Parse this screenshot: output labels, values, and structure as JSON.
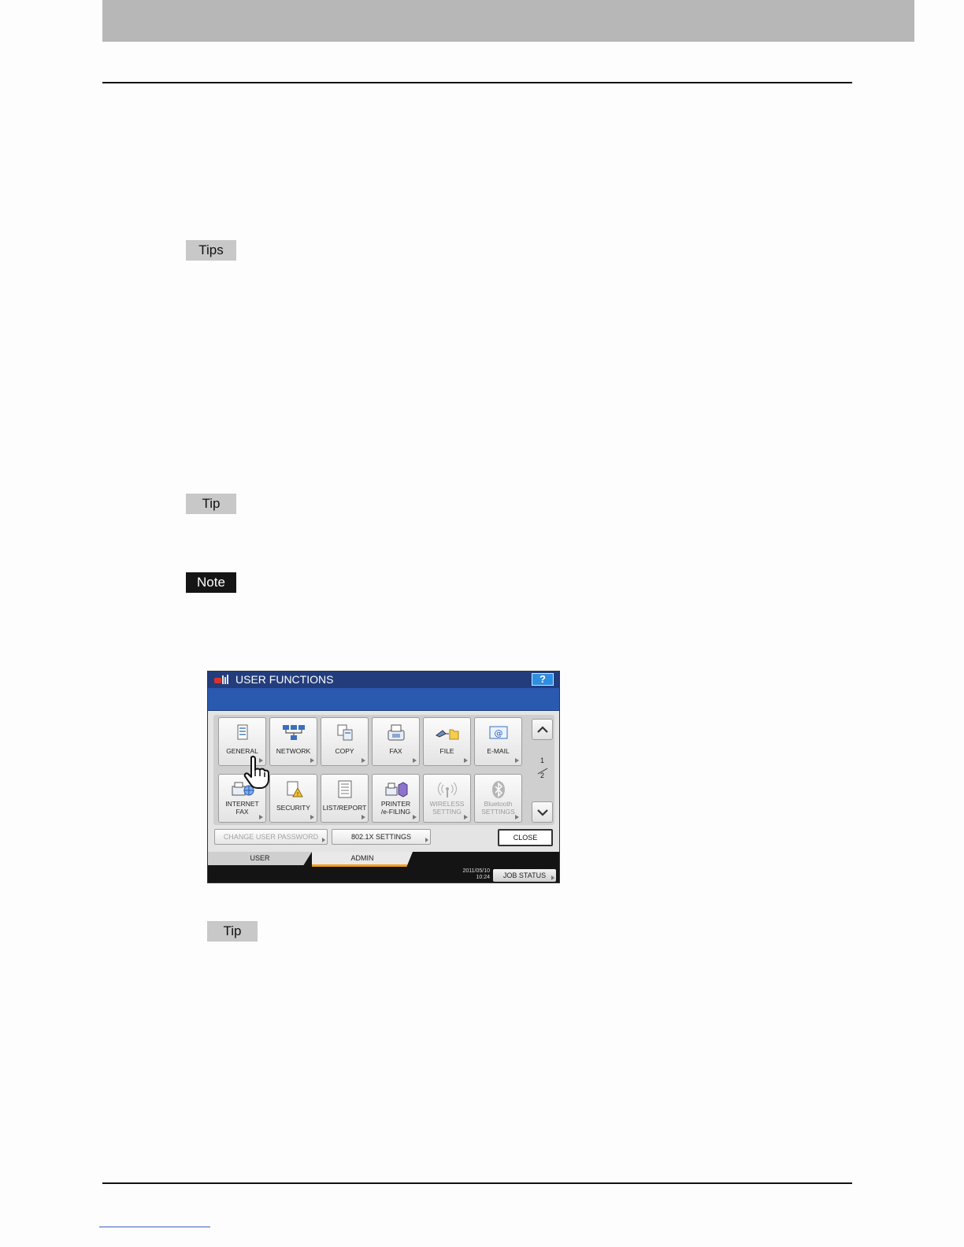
{
  "page": {
    "tags": {
      "tips": "Tips",
      "tip_1": "Tip",
      "note": "Note",
      "tip_2": "Tip"
    }
  },
  "screen": {
    "title": "USER FUNCTIONS",
    "help_label": "?",
    "row1": [
      {
        "label": "GENERAL",
        "icon": "general-icon"
      },
      {
        "label": "NETWORK",
        "icon": "network-icon"
      },
      {
        "label": "COPY",
        "icon": "copy-icon"
      },
      {
        "label": "FAX",
        "icon": "fax-icon"
      },
      {
        "label": "FILE",
        "icon": "file-icon"
      },
      {
        "label": "E-MAIL",
        "icon": "email-icon"
      }
    ],
    "row2": [
      {
        "label": "INTERNET\nFAX",
        "icon": "internet-fax-icon"
      },
      {
        "label": "SECURITY",
        "icon": "security-icon"
      },
      {
        "label": "LIST/REPORT",
        "icon": "list-report-icon"
      },
      {
        "label": "PRINTER\n/e-FILING",
        "icon": "printer-efiling-icon"
      },
      {
        "label": "WIRELESS\nSETTING",
        "icon": "wireless-icon",
        "disabled": true
      },
      {
        "label": "Bluetooth\nSETTINGS",
        "icon": "bluetooth-icon",
        "disabled": true
      }
    ],
    "page_current": "1",
    "page_total": "2",
    "change_password_label": "CHANGE USER PASSWORD",
    "dot1x_label": "802.1X SETTINGS",
    "close_label": "CLOSE",
    "tabs": {
      "user": "USER",
      "admin": "ADMIN"
    },
    "date": "2011/05/10",
    "time": "10:24",
    "job_status_label": "JOB STATUS",
    "colors": {
      "title_bar": "#233d7c",
      "sub_bar": "#2a59b0",
      "active_tab_accent": "#f0a020"
    }
  }
}
